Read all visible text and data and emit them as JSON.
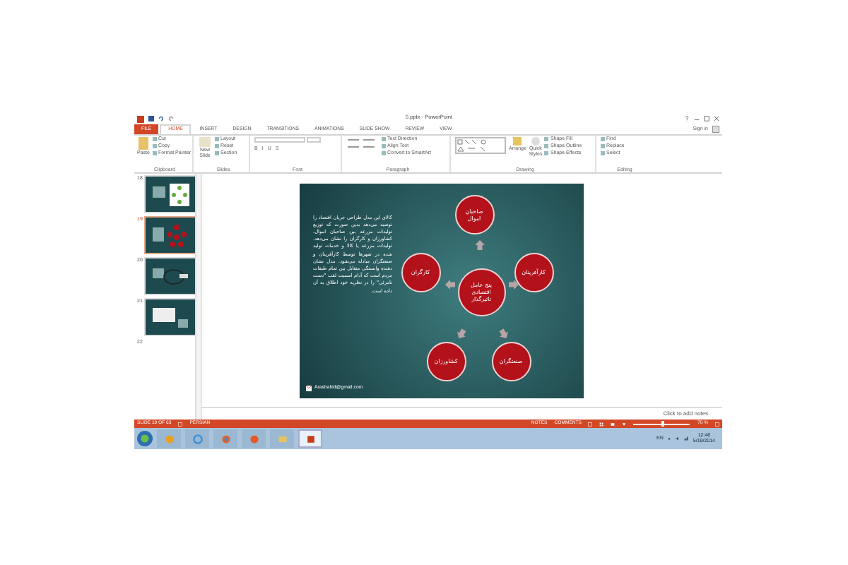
{
  "window": {
    "title": "5.pptx - PowerPoint"
  },
  "tabs": [
    {
      "label": "FILE",
      "kind": "file",
      "selected": false
    },
    {
      "label": "HOME",
      "kind": "tab",
      "selected": true
    },
    {
      "label": "INSERT",
      "kind": "tab",
      "selected": false
    },
    {
      "label": "DESIGN",
      "kind": "tab",
      "selected": false
    },
    {
      "label": "TRANSITIONS",
      "kind": "tab",
      "selected": false
    },
    {
      "label": "ANIMATIONS",
      "kind": "tab",
      "selected": false
    },
    {
      "label": "SLIDE SHOW",
      "kind": "tab",
      "selected": false
    },
    {
      "label": "REVIEW",
      "kind": "tab",
      "selected": false
    },
    {
      "label": "VIEW",
      "kind": "tab",
      "selected": false
    }
  ],
  "sign_in": "Sign in",
  "ribbon": {
    "clipboard": {
      "label": "Clipboard",
      "paste": "Paste",
      "items": [
        "Cut",
        "Copy",
        "Format Painter"
      ]
    },
    "slides": {
      "label": "Slides",
      "new_slide": "New Slide",
      "items": [
        "Layout",
        "Reset",
        "Section"
      ]
    },
    "font": {
      "label": "Font",
      "format_buttons": [
        "B",
        "I",
        "U",
        "S"
      ]
    },
    "paragraph": {
      "label": "Paragraph",
      "items": [
        "Text Direction",
        "Align Text",
        "Convert to SmartArt"
      ]
    },
    "drawing": {
      "label": "Drawing",
      "arrange": "Arrange",
      "quick_styles": "Quick Styles",
      "items": [
        "Shape Fill",
        "Shape Outline",
        "Shape Effects"
      ]
    },
    "editing": {
      "label": "Editing",
      "items": [
        "Find",
        "Replace",
        "Select"
      ]
    }
  },
  "thumbnails": [
    {
      "number": "18",
      "kind": "cycle",
      "selected": false
    },
    {
      "number": "19",
      "kind": "nodes",
      "selected": true
    },
    {
      "number": "20",
      "kind": "loop",
      "selected": false
    },
    {
      "number": "21",
      "kind": "box",
      "selected": false
    },
    {
      "number": "22",
      "kind": "partial",
      "selected": false
    }
  ],
  "slide": {
    "body": "کالای این مدل طراحی جریان اقتصاد را توصیه می‌دهد بدین صورت که توزیع تولیدات مزرعه بین صاحبان اموال، کشاورزان و کارگران را نشان می‌دهد. تولیدات مزرعه یا کالا و خدمات تولید شده در شهرها توسط کارآفرینان و صنعتگران مبادله می‌شود. مدل نشان دهنده وابستگی متقابل بین تمام طبقات مردم است که آدام اسمیت لقب \"دست نامرئی\" را در نظریه خود اطلاق به آن داده است.",
    "center": "پنج عامل اقتصادی تاثیرگذار",
    "nodes": [
      "صاحبان اموال",
      "کارآفرینان",
      "صنعتگران",
      "کشاورزان",
      "کارگران"
    ],
    "email": "Arashahid@gmail.com"
  },
  "notes_placeholder": "Click to add notes",
  "status_bar": {
    "slide_info": "SLIDE 19 OF 63",
    "language": "PERSIAN",
    "notes": "NOTES",
    "comments": "COMMENTS",
    "zoom": "78 %",
    "level": 0.5
  },
  "taskbar": {
    "apps": [
      {
        "kind": "media",
        "selected": false
      },
      {
        "kind": "ie",
        "selected": false
      },
      {
        "kind": "chrome",
        "selected": false
      },
      {
        "kind": "firefox",
        "selected": false
      },
      {
        "kind": "folder",
        "selected": false
      },
      {
        "kind": "powerpoint",
        "selected": true
      }
    ],
    "language": "EN",
    "time": "12:46",
    "date": "5/19/2014"
  }
}
